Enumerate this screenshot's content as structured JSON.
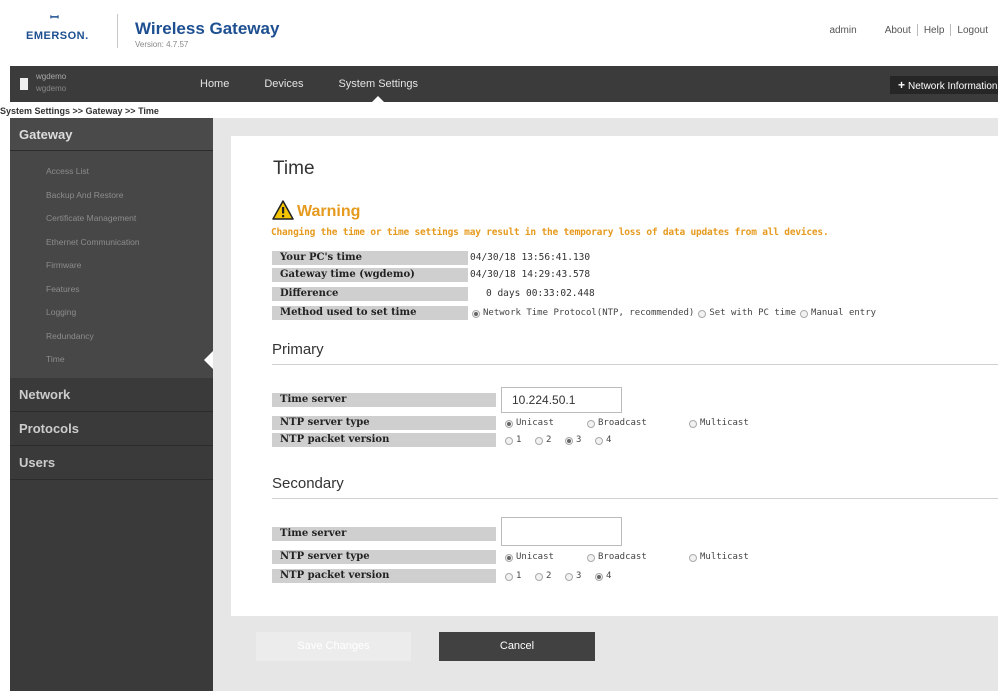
{
  "header": {
    "brand_mark": "ꟷ",
    "brand": "EMERSON.",
    "title": "Wireless Gateway",
    "version": "Version: 4.7.57",
    "user": "admin",
    "links": [
      "About",
      "Help",
      "Logout"
    ]
  },
  "navbar": {
    "device_name": "wgdemo",
    "device_sub": "wgdemo",
    "items": [
      "Home",
      "Devices",
      "System Settings"
    ],
    "active": "System Settings",
    "network_info": "Network Information"
  },
  "breadcrumb": "System Settings >> Gateway >> Time",
  "sidebar": {
    "gateway_label": "Gateway",
    "items": [
      "Access List",
      "Backup And Restore",
      "Certificate Management",
      "Ethernet Communication",
      "Firmware",
      "Features",
      "Logging",
      "Redundancy",
      "Time"
    ],
    "active_item": "Time",
    "sections": [
      "Network",
      "Protocols",
      "Users"
    ]
  },
  "page": {
    "title": "Time",
    "warning_title": "Warning",
    "warning_text": "Changing the time or time settings may result in the temporary loss of data updates from all devices.",
    "info": [
      {
        "label": "Your PC's time",
        "value": "04/30/18 13:56:41.130"
      },
      {
        "label": "Gateway time (wgdemo)",
        "value": "04/30/18 14:29:43.578"
      },
      {
        "label": "Difference",
        "value": "0 days 00:33:02.448"
      }
    ],
    "method_label": "Method used to set time",
    "method_options": [
      "Network Time Protocol(NTP, recommended)",
      "Set with PC time",
      "Manual entry"
    ],
    "method_selected": 0,
    "primary": {
      "heading": "Primary",
      "time_server_label": "Time server",
      "time_server_value": "10.224.50.1",
      "server_type_label": "NTP server type",
      "server_type_options": [
        "Unicast",
        "Broadcast",
        "Multicast"
      ],
      "server_type_selected": 0,
      "packet_version_label": "NTP packet version",
      "packet_version_options": [
        "1",
        "2",
        "3",
        "4"
      ],
      "packet_version_selected": 2
    },
    "secondary": {
      "heading": "Secondary",
      "time_server_label": "Time server",
      "time_server_value": "",
      "server_type_label": "NTP server type",
      "server_type_options": [
        "Unicast",
        "Broadcast",
        "Multicast"
      ],
      "server_type_selected": 0,
      "packet_version_label": "NTP packet version",
      "packet_version_options": [
        "1",
        "2",
        "3",
        "4"
      ],
      "packet_version_selected": 3
    },
    "save_label": "Save Changes",
    "cancel_label": "Cancel"
  },
  "colors": {
    "warning": "#e69a1e",
    "brand": "#1d4f91",
    "nav": "#3b3b3b",
    "sidebar": "#3a3a3a"
  }
}
